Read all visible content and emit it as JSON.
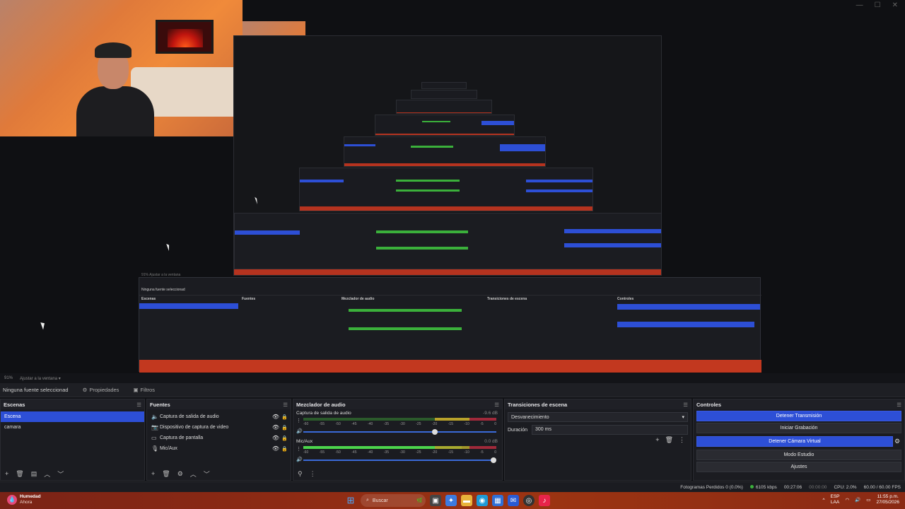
{
  "window_controls": [
    "—",
    "☐",
    "✕"
  ],
  "zoom_row": {
    "zoom": "91%",
    "fit_label": "Ajustar a la ventana"
  },
  "props_row": {
    "no_source": "Ninguna fuente seleccionad",
    "properties": "Propiedades",
    "filters": "Filtros"
  },
  "scenes": {
    "title": "Escenas",
    "items": [
      "Escena",
      "camara"
    ],
    "selected": 0
  },
  "sources": {
    "title": "Fuentes",
    "items": [
      {
        "label": "Captura de salida de audio",
        "icon": "speaker-icon"
      },
      {
        "label": "Dispositivo de captura de video",
        "icon": "camera-icon"
      },
      {
        "label": "Captura de pantalla",
        "icon": "monitor-icon"
      },
      {
        "label": "Mic/Aux",
        "icon": "mic-icon"
      }
    ]
  },
  "mixer": {
    "title": "Mezclador de audio",
    "channels": [
      {
        "name": "Captura de salida de audio",
        "db": "-9.6 dB",
        "level": 0.0,
        "volume": 0.68
      },
      {
        "name": "Mic/Aux",
        "db": "0.0 dB",
        "level": 0.82,
        "volume": 1.0
      }
    ],
    "ticks": [
      "-60",
      "-55",
      "-50",
      "-45",
      "-40",
      "-35",
      "-30",
      "-25",
      "-20",
      "-15",
      "-10",
      "-5",
      "0"
    ]
  },
  "transitions": {
    "title": "Transiciones de escena",
    "selected": "Desvanecimiento",
    "duration_label": "Duración",
    "duration_value": "300 ms"
  },
  "controls": {
    "title": "Controles",
    "buttons": [
      {
        "label": "Detener Transmisión",
        "active": true
      },
      {
        "label": "Iniciar Grabación",
        "active": false
      },
      {
        "label": "Detener Cámara Virtual",
        "active": true
      },
      {
        "label": "Modo Estudio",
        "active": false
      },
      {
        "label": "Ajustes",
        "active": false
      }
    ]
  },
  "stats": {
    "dropped": "Fotogramas Perdidos 0 (0.0%)",
    "bitrate": "6105 kbps",
    "stream_time": "00:27:06",
    "rec_time": "00:00:00",
    "cpu": "CPU: 2.0%",
    "fps": "60.00 / 60.00 FPS"
  },
  "taskbar": {
    "weather_title": "Humedad",
    "weather_sub": "Ahora",
    "search": "Buscar",
    "lang": "ESP",
    "lang2": "LAA",
    "time": "11:55 p.m.",
    "date": "27/05/2026"
  },
  "colors": {
    "accent": "#2d4fd6",
    "taskbar": "#8c2a14"
  }
}
